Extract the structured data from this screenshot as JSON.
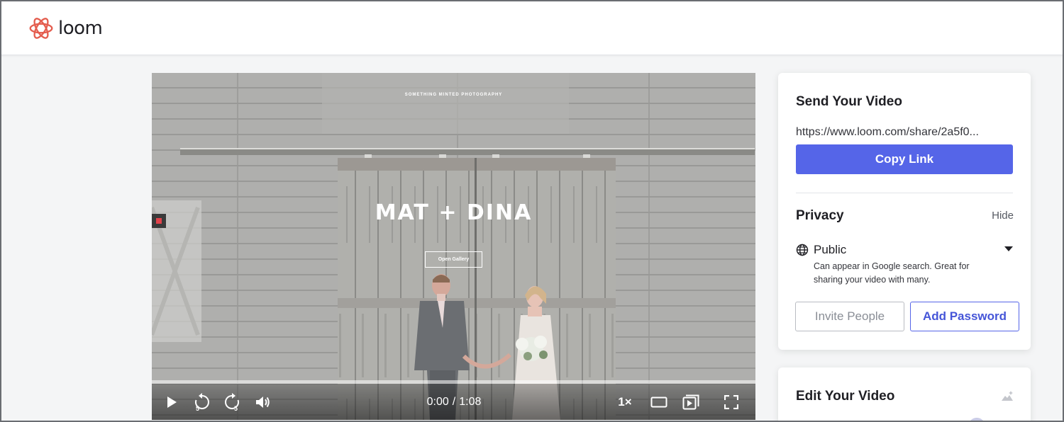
{
  "app": {
    "logo_text": "loom",
    "brand_color": "#e45d4e",
    "accent_color": "#5565e8"
  },
  "video": {
    "brand_line": "SOMETHING MINTED PHOTOGRAPHY",
    "title": "MAT + DINA",
    "gallery_button": "Open Gallery",
    "time_current": "0:00",
    "time_separator": "/",
    "time_total": "1:08",
    "speed": "1×",
    "progress_fraction": 0,
    "controls": {
      "play": "play-icon",
      "rewind": "rewind-5-icon",
      "forward": "forward-5-icon",
      "volume": "volume-icon",
      "theater": "theater-mode-icon",
      "pip": "picture-in-picture-icon",
      "fullscreen": "fullscreen-icon"
    }
  },
  "send_card": {
    "title": "Send Your Video",
    "share_url": "https://www.loom.com/share/2a5f0...",
    "copy_button": "Copy Link",
    "privacy_title": "Privacy",
    "hide_link": "Hide",
    "privacy_value": "Public",
    "privacy_description": "Can appear in Google search. Great for sharing your video with many.",
    "invite_button": "Invite People",
    "password_button": "Add Password"
  },
  "edit_card": {
    "title": "Edit Your Video"
  }
}
